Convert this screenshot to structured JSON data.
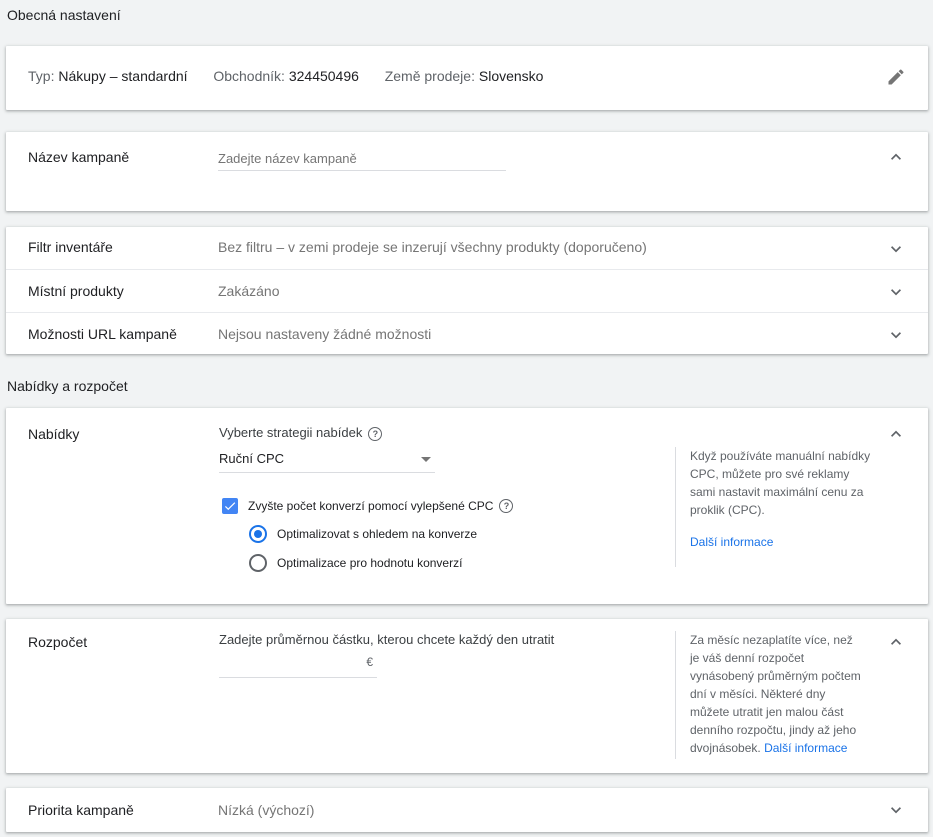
{
  "general": {
    "title": "Obecná nastavení",
    "type_label": "Typ:",
    "type_value": "Nákupy – standardní",
    "merchant_label": "Obchodník:",
    "merchant_value": "324450496",
    "country_label": "Země prodeje:",
    "country_value": "Slovensko"
  },
  "campaign_name": {
    "label": "Název kampaně",
    "placeholder": "Zadejte název kampaně"
  },
  "settings_rows": [
    {
      "label": "Filtr inventáře",
      "value": "Bez filtru – v zemi prodeje se inzerují všechny produkty (doporučeno)"
    },
    {
      "label": "Místní produkty",
      "value": "Zakázáno"
    },
    {
      "label": "Možnosti URL kampaně",
      "value": "Nejsou nastaveny žádné možnosti"
    }
  ],
  "bids_section": {
    "title": "Nabídky a rozpočet"
  },
  "bids": {
    "label": "Nabídky",
    "strategy_prompt": "Vyberte strategii nabídek",
    "strategy_value": "Ruční CPC",
    "enhanced_cpc_label": "Zvyšte počet konverzí pomocí vylepšené CPC",
    "enhanced_cpc_checked": true,
    "radio_options": [
      {
        "label": "Optimalizovat s ohledem na konverze",
        "selected": true
      },
      {
        "label": "Optimalizace pro hodnotu konverzí",
        "selected": false
      }
    ],
    "side_note": "Když používáte manuální nabídky CPC, můžete pro své reklamy sami nastavit maximální cenu za proklik (CPC).",
    "side_link": "Další informace"
  },
  "budget": {
    "label": "Rozpočet",
    "prompt": "Zadejte průměrnou částku, kterou chcete každý den utratit",
    "currency": "€",
    "side_note": "Za měsíc nezaplatíte více, než je váš denní rozpočet vynásobený průměrným počtem dní v měsíci. Některé dny můžete utratit jen malou část denního rozpočtu, jindy až jeho dvojnásobek.",
    "side_link": "Další informace"
  },
  "priority": {
    "label": "Priorita kampaně",
    "value": "Nízká (výchozí)"
  },
  "colors": {
    "accent": "#1a73e8",
    "checkbox": "#4285f4",
    "background": "#f1f3f4"
  }
}
